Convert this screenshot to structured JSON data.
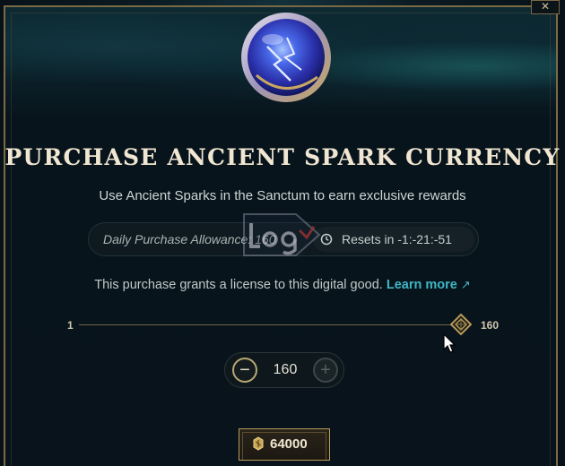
{
  "dialog": {
    "title": "PURCHASE ANCIENT SPARK CURRENCY",
    "subtitle": "Use Ancient Sparks in the Sanctum to earn exclusive rewards",
    "close_label": "✕"
  },
  "allowance": {
    "label": "Daily Purchase Allowance: ",
    "value": "160",
    "reset_text": "Resets in -1:-21:-51"
  },
  "license": {
    "text": "This purchase grants a license to this digital good. ",
    "link_label": "Learn more",
    "link_icon": "↗"
  },
  "slider": {
    "min_label": "1",
    "max_label": "160",
    "value_fraction": 1.0
  },
  "stepper": {
    "minus_label": "−",
    "value": "160",
    "plus_label": "+"
  },
  "purchase_button": {
    "label": "64000",
    "icon": "coin-icon"
  },
  "icons": [
    "orb-icon",
    "clock-icon",
    "diamond-handle-icon",
    "cursor-icon",
    "coin-icon",
    "external-link-icon"
  ],
  "colors": {
    "gold": "#b69a5a",
    "accent_link": "#3fb7c4",
    "title": "#f0e6d2",
    "background": "#08131b"
  }
}
